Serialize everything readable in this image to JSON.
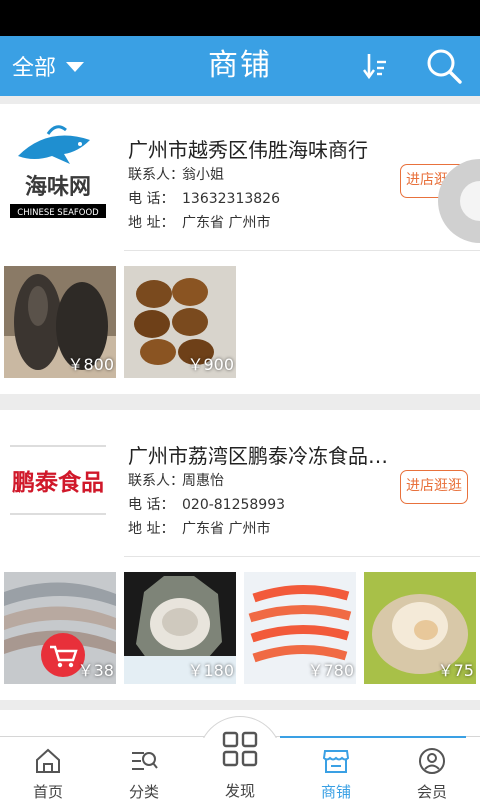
{
  "header": {
    "filter_label": "全部",
    "title": "商铺",
    "sort_icon": "sort-icon",
    "search_icon": "search-icon"
  },
  "shops": [
    {
      "name": "广州市越秀区伟胜海味商行",
      "contact_label": "联系人：",
      "contact": "翁小姐",
      "phone_label": "电    话：",
      "phone": "13632313826",
      "address_label": "地    址：",
      "address": "广东省 广州市",
      "visit_button": "进店逛逛",
      "logo_text": "海味网",
      "logo_subtext": "CHINESE SEAFOOD",
      "products": [
        {
          "price": "￥800"
        },
        {
          "price": "￥900"
        }
      ]
    },
    {
      "name": "广州市荔湾区鹏泰冷冻食品商...",
      "contact_label": "联系人：",
      "contact": "周惠怡",
      "phone_label": "电    话：",
      "phone": "020-81258993",
      "address_label": "地    址：",
      "address": "广东省 广州市",
      "visit_button": "进店逛逛",
      "logo_text": "鹏泰食品",
      "products": [
        {
          "price": "￥38"
        },
        {
          "price": "￥180"
        },
        {
          "price": "￥780"
        },
        {
          "price": "￥75"
        }
      ]
    }
  ],
  "tabs": [
    {
      "label": "首页",
      "icon": "home-icon"
    },
    {
      "label": "分类",
      "icon": "category-search-icon"
    },
    {
      "label": "发现",
      "icon": "grid-icon"
    },
    {
      "label": "商铺",
      "icon": "shop-icon",
      "active": true
    },
    {
      "label": "会员",
      "icon": "user-icon"
    }
  ],
  "colors": {
    "primary": "#3aa0e4",
    "accent": "#e8713c",
    "cart": "#e8303a"
  }
}
